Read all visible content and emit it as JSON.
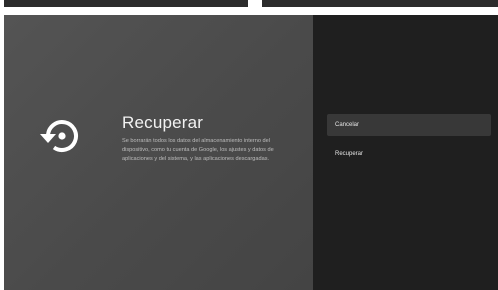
{
  "dialog": {
    "title": "Recuperar",
    "description": "Se borrarán todos los datos del almacenamiento interno del dispositivo, como tu cuenta de Google, los ajustes y datos de aplicaciones y del sistema, y las aplicaciones descargadas."
  },
  "menu": {
    "items": [
      {
        "label": "Cancelar"
      },
      {
        "label": "Recuperar"
      }
    ]
  },
  "icons": {
    "main": "restore-icon"
  },
  "colors": {
    "left_panel": "#4c4c4c",
    "right_panel": "#1f1f1f",
    "focused_item": "#383838"
  }
}
